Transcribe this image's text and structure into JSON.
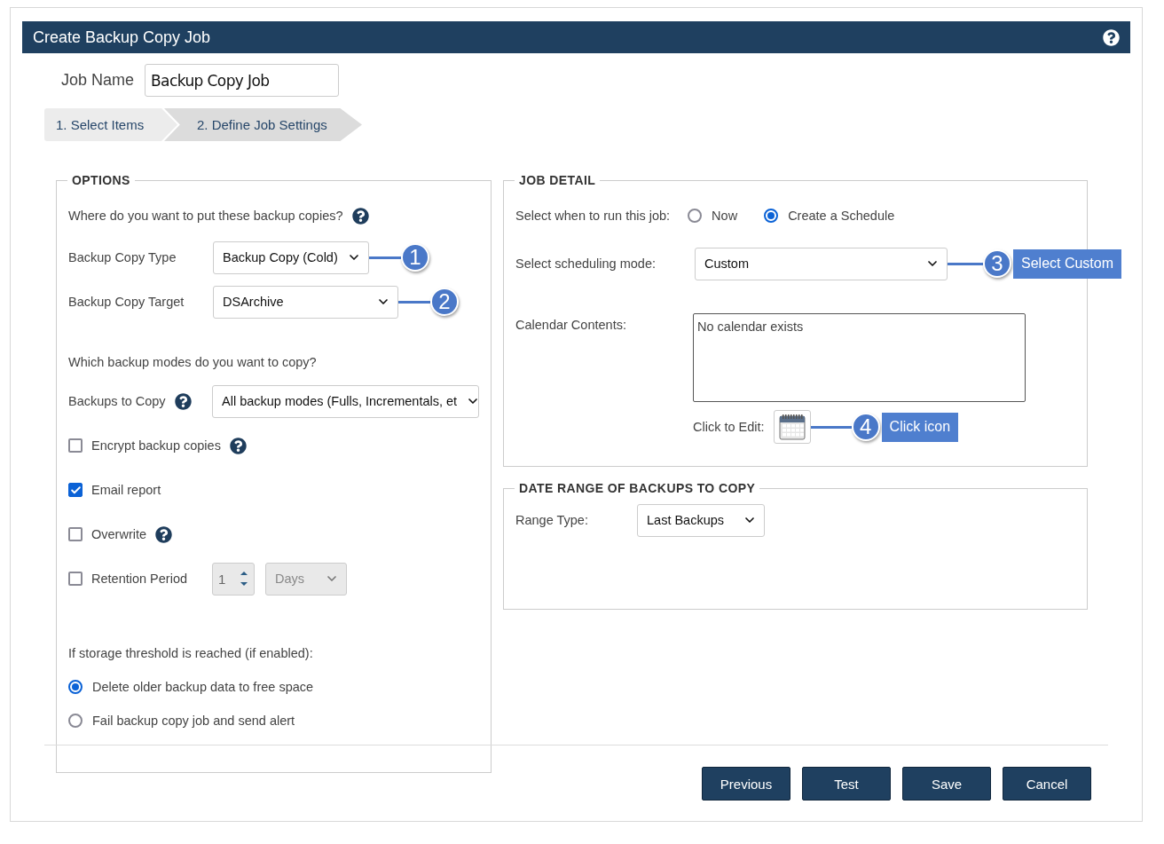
{
  "window": {
    "title": "Create Backup Copy Job"
  },
  "job_name": {
    "label": "Job Name",
    "value": "Backup Copy Job"
  },
  "steps": [
    {
      "label": "1. Select Items",
      "selected": false
    },
    {
      "label": "2. Define Job Settings",
      "selected": true
    }
  ],
  "options": {
    "legend": "OPTIONS",
    "items": [
      {
        "kind": "heading",
        "text": "Where do you want to put these backup copies?",
        "help": true
      },
      {
        "kind": "select",
        "label": "Backup Copy Type",
        "value": "Backup Copy (Cold)",
        "help": false,
        "callout": {
          "number": "1"
        }
      },
      {
        "kind": "select",
        "label": "Backup Copy Target",
        "value": "DSArchive",
        "help": false,
        "callout": {
          "number": "2"
        }
      },
      {
        "kind": "heading",
        "text": "Which backup modes do you want to copy?",
        "help": false
      },
      {
        "kind": "select",
        "label": "Backups to Copy",
        "value": "All backup modes (Fulls, Incrementals, et",
        "help": true
      },
      {
        "kind": "checkbox",
        "label": "Encrypt backup copies",
        "checked": false,
        "help": true
      },
      {
        "kind": "checkbox",
        "label": "Email report",
        "checked": true,
        "help": false
      },
      {
        "kind": "checkbox",
        "label": "Overwrite",
        "checked": false,
        "help": true
      },
      {
        "kind": "retention",
        "label": "Retention Period",
        "checked": false,
        "number": "1",
        "unit": "Days",
        "disabled": true
      },
      {
        "kind": "heading",
        "text": "If storage threshold is reached (if enabled):",
        "help": false
      },
      {
        "kind": "radio",
        "label": "Delete older backup data to free space",
        "selected": true
      },
      {
        "kind": "radio",
        "label": "Fail backup copy job and send alert",
        "selected": false
      }
    ]
  },
  "job_detail": {
    "legend": "JOB DETAIL",
    "run_label": "Select when to run this job:",
    "run_options": [
      {
        "label": "Now",
        "selected": false
      },
      {
        "label": "Create a Schedule",
        "selected": true
      }
    ],
    "mode_label": "Select scheduling mode:",
    "mode_value": "Custom",
    "mode_callout": {
      "number": "3",
      "label": "Select Custom"
    },
    "calendar_label": "Calendar Contents:",
    "calendar_text": "No calendar exists",
    "edit_label": "Click to Edit:",
    "edit_callout": {
      "number": "4",
      "label": "Click icon"
    }
  },
  "date_range": {
    "legend": "DATE RANGE OF BACKUPS TO COPY",
    "range_label": "Range Type:",
    "range_value": "Last Backups"
  },
  "buttons": [
    "Previous",
    "Test",
    "Save",
    "Cancel"
  ]
}
